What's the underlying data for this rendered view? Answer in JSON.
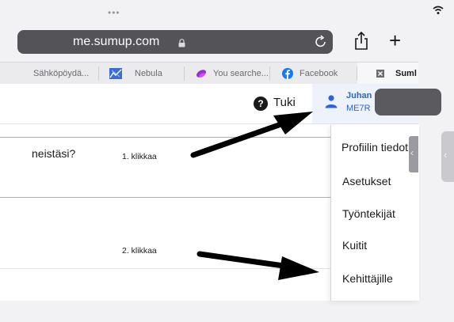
{
  "browser": {
    "url": "me.sumup.com",
    "tabs": [
      {
        "label": "Sähköpöydä..."
      },
      {
        "label": "Nebula"
      },
      {
        "label": "You searche..."
      },
      {
        "label": "Facebook"
      },
      {
        "label": "Suml"
      }
    ]
  },
  "header": {
    "help_label": "Tuki",
    "help_glyph": "?",
    "user_name": "Juhan",
    "user_id": "ME7R"
  },
  "content": {
    "question": "neistäsi?",
    "note1": "1. klikkaa",
    "note2": "2. klikkaa"
  },
  "menu": {
    "items": [
      {
        "label": "Profiilin tiedot"
      },
      {
        "label": "Asetukset"
      },
      {
        "label": "Työntekijät"
      },
      {
        "label": "Kuitit"
      },
      {
        "label": "Kehittäjille"
      }
    ]
  },
  "colors": {
    "accent": "#2b63d9",
    "orange_divider": "#f3a23a",
    "url_bar": "#535358"
  },
  "icons": [
    "wifi-icon",
    "lock-icon",
    "reload-icon",
    "share-icon",
    "plus-icon",
    "help-icon",
    "user-icon",
    "arrow-annotation"
  ]
}
